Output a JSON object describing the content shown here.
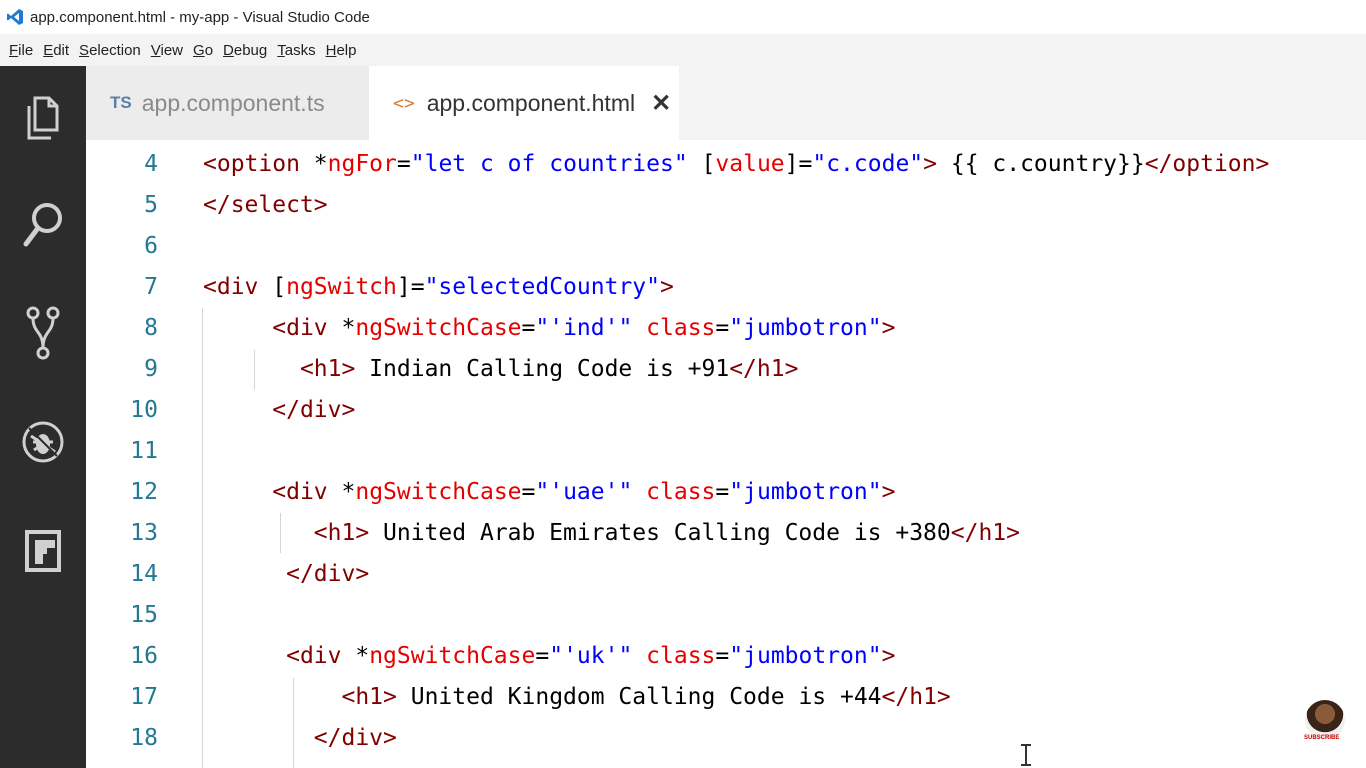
{
  "window": {
    "title": "app.component.html - my-app - Visual Studio Code"
  },
  "menu": {
    "items": [
      {
        "first": "F",
        "rest": "ile"
      },
      {
        "first": "E",
        "rest": "dit"
      },
      {
        "first": "S",
        "rest": "election"
      },
      {
        "first": "V",
        "rest": "iew"
      },
      {
        "first": "G",
        "rest": "o"
      },
      {
        "first": "D",
        "rest": "ebug"
      },
      {
        "first": "T",
        "rest": "asks"
      },
      {
        "first": "H",
        "rest": "elp"
      }
    ]
  },
  "activity_bar": {
    "icons": [
      "explorer-icon",
      "search-icon",
      "source-control-icon",
      "debug-icon",
      "extensions-icon"
    ]
  },
  "tabs": [
    {
      "badge": "TS",
      "label": "app.component.ts",
      "active": false
    },
    {
      "badge": "<>",
      "label": "app.component.html",
      "active": true,
      "close": "✕"
    }
  ],
  "editor": {
    "lines": [
      {
        "num": "4",
        "code": [
          [
            "t",
            "<option"
          ],
          [
            "p",
            " *"
          ],
          [
            "a",
            "ngFor"
          ],
          [
            "p",
            "="
          ],
          [
            "s",
            "\"let c of countries\""
          ],
          [
            "p",
            " ["
          ],
          [
            "a",
            "value"
          ],
          [
            "p",
            "]="
          ],
          [
            "s",
            "\"c.code\""
          ],
          [
            "t",
            ">"
          ],
          [
            "p",
            " {{ c.country}}"
          ],
          [
            "t",
            "</option>"
          ]
        ]
      },
      {
        "num": "5",
        "code": [
          [
            "t",
            "</select>"
          ]
        ]
      },
      {
        "num": "6",
        "code": []
      },
      {
        "num": "7",
        "code": [
          [
            "t",
            "<div"
          ],
          [
            "p",
            " ["
          ],
          [
            "a",
            "ngSwitch"
          ],
          [
            "p",
            "]="
          ],
          [
            "s",
            "\"selectedCountry\""
          ],
          [
            "t",
            ">"
          ]
        ]
      },
      {
        "num": "8",
        "code": [
          [
            "p",
            "     "
          ],
          [
            "t",
            "<div"
          ],
          [
            "p",
            " *"
          ],
          [
            "a",
            "ngSwitchCase"
          ],
          [
            "p",
            "="
          ],
          [
            "s",
            "\"'ind'\""
          ],
          [
            "p",
            " "
          ],
          [
            "a",
            "class"
          ],
          [
            "p",
            "="
          ],
          [
            "s",
            "\"jumbotron\""
          ],
          [
            "t",
            ">"
          ]
        ]
      },
      {
        "num": "9",
        "code": [
          [
            "p",
            "       "
          ],
          [
            "t",
            "<h1>"
          ],
          [
            "p",
            " Indian Calling Code is +91"
          ],
          [
            "t",
            "</h1>"
          ]
        ]
      },
      {
        "num": "10",
        "code": [
          [
            "p",
            "     "
          ],
          [
            "t",
            "</div>"
          ]
        ]
      },
      {
        "num": "11",
        "code": []
      },
      {
        "num": "12",
        "code": [
          [
            "p",
            "     "
          ],
          [
            "t",
            "<div"
          ],
          [
            "p",
            " *"
          ],
          [
            "a",
            "ngSwitchCase"
          ],
          [
            "p",
            "="
          ],
          [
            "s",
            "\"'uae'\""
          ],
          [
            "p",
            " "
          ],
          [
            "a",
            "class"
          ],
          [
            "p",
            "="
          ],
          [
            "s",
            "\"jumbotron\""
          ],
          [
            "t",
            ">"
          ]
        ]
      },
      {
        "num": "13",
        "code": [
          [
            "p",
            "        "
          ],
          [
            "t",
            "<h1>"
          ],
          [
            "p",
            " United Arab Emirates Calling Code is +380"
          ],
          [
            "t",
            "</h1>"
          ]
        ]
      },
      {
        "num": "14",
        "code": [
          [
            "p",
            "      "
          ],
          [
            "t",
            "</div>"
          ]
        ]
      },
      {
        "num": "15",
        "code": []
      },
      {
        "num": "16",
        "code": [
          [
            "p",
            "      "
          ],
          [
            "t",
            "<div"
          ],
          [
            "p",
            " *"
          ],
          [
            "a",
            "ngSwitchCase"
          ],
          [
            "p",
            "="
          ],
          [
            "s",
            "\"'uk'\""
          ],
          [
            "p",
            " "
          ],
          [
            "a",
            "class"
          ],
          [
            "p",
            "="
          ],
          [
            "s",
            "\"jumbotron\""
          ],
          [
            "t",
            ">"
          ]
        ]
      },
      {
        "num": "17",
        "code": [
          [
            "p",
            "          "
          ],
          [
            "t",
            "<h1>"
          ],
          [
            "p",
            " United Kingdom Calling Code is +44"
          ],
          [
            "t",
            "</h1>"
          ]
        ]
      },
      {
        "num": "18",
        "code": [
          [
            "p",
            "        "
          ],
          [
            "t",
            "</div>"
          ]
        ]
      }
    ]
  },
  "overlay": {
    "subscribe_label": "SUBSCRIBE"
  },
  "colors": {
    "tag": "#800000",
    "attribute": "#e50000",
    "string": "#0000ff",
    "line_number": "#237893",
    "activity_bar": "#2c2c2c"
  }
}
